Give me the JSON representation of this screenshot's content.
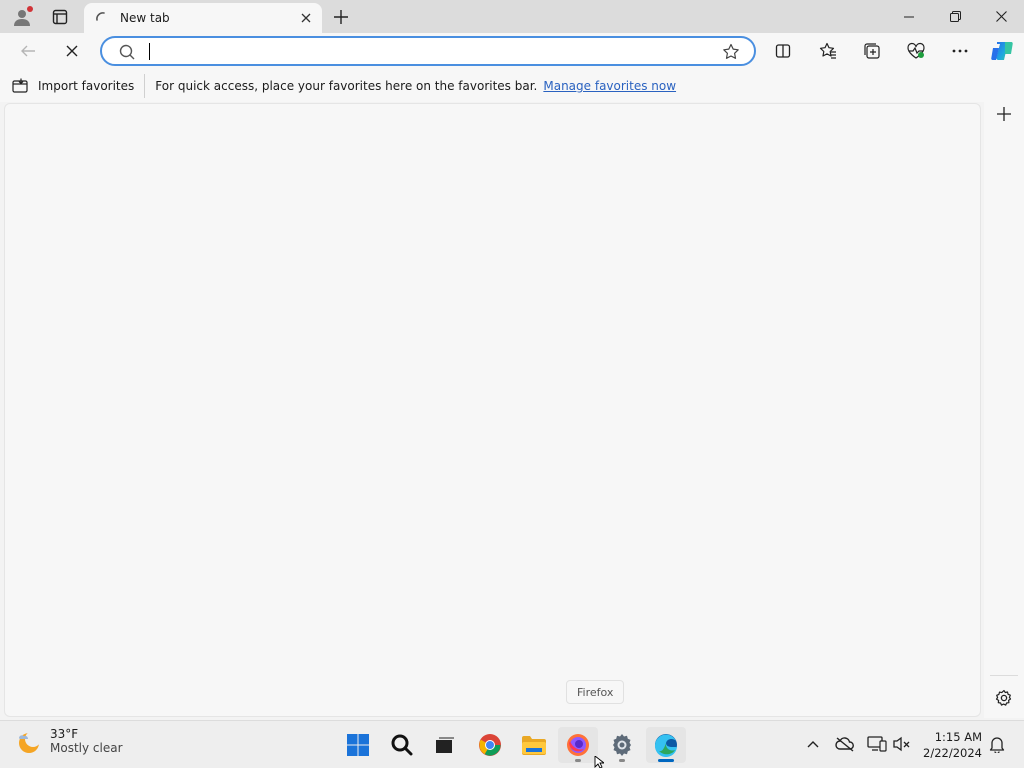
{
  "browser": {
    "tab": {
      "title": "New tab"
    },
    "address_bar": {
      "value": "",
      "placeholder": ""
    },
    "favorites_bar": {
      "import_label": "Import favorites",
      "message": "For quick access, place your favorites here on the favorites bar.",
      "manage_link": "Manage favorites now"
    },
    "tooltip": "Firefox"
  },
  "taskbar": {
    "weather": {
      "temp": "33°F",
      "condition": "Mostly clear"
    },
    "apps": [
      "windows-start",
      "search",
      "task-view",
      "chrome",
      "file-explorer",
      "firefox",
      "settings",
      "edge"
    ],
    "clock": {
      "time": "1:15 AM",
      "date": "2/22/2024"
    }
  },
  "colors": {
    "accent": "#4a8fe0",
    "link": "#2a62c0",
    "edge_blue": "#0067c0",
    "notification_red": "#d13438"
  }
}
